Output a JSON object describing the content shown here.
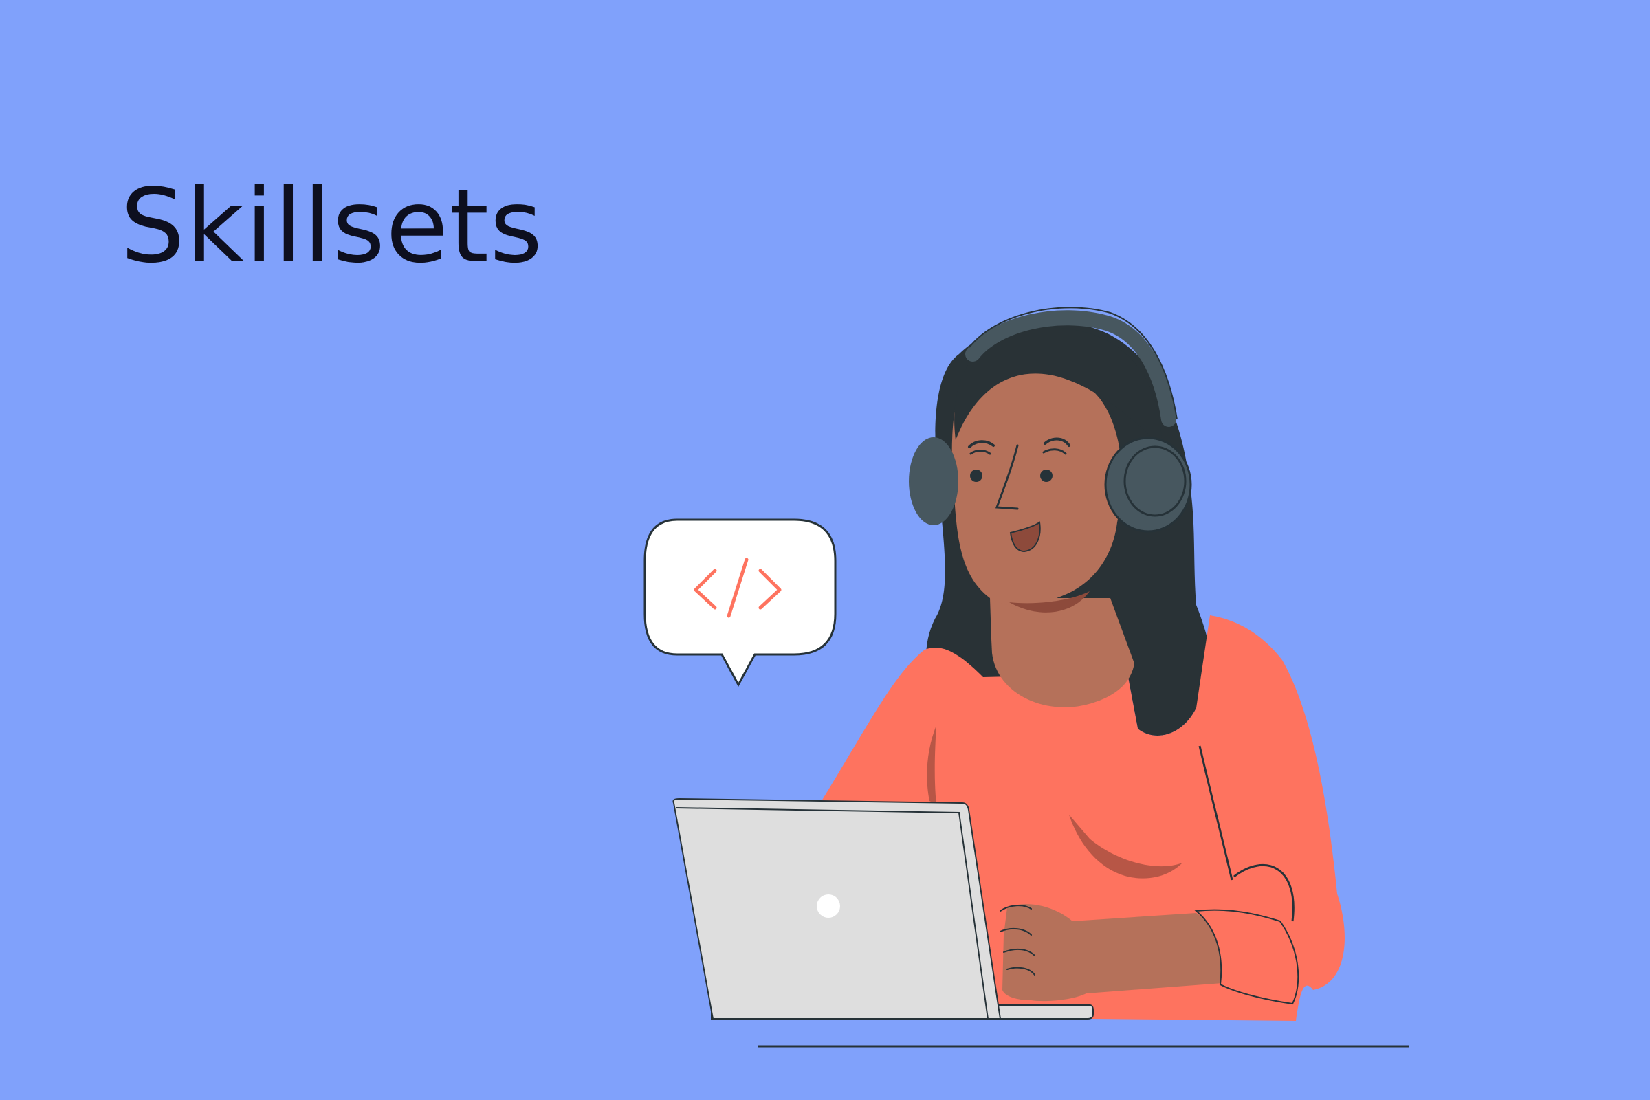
{
  "page": {
    "heading": "Skillsets"
  },
  "illustration": {
    "bubble_icon": "code-brackets-icon",
    "colors": {
      "background": "#80a1fb",
      "skin": "#b5715a",
      "skin_shadow": "#8d4a3b",
      "hair": "#293236",
      "headphones": "#47575f",
      "sweater": "#fe735f",
      "sweater_shadow": "#b75646",
      "laptop": "#dedede",
      "outline": "#263238",
      "bubble": "#ffffff",
      "code_icon": "#fe735f",
      "heading": "#0d0f1f"
    }
  }
}
